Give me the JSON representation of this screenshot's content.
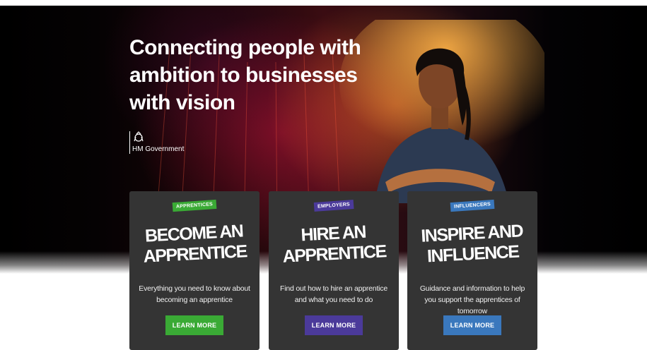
{
  "hero": {
    "title": "Connecting people with ambition to businesses with vision",
    "government_label": "HM Government"
  },
  "cards": [
    {
      "tag": "APPRENTICES",
      "title_line1": "BECOME AN",
      "title_line2": "APPRENTICE",
      "description": "Everything you need to know about becoming an apprentice",
      "button": "LEARN MORE",
      "accent": "#3aaa35"
    },
    {
      "tag": "EMPLOYERS",
      "title_line1": "HIRE AN",
      "title_line2": "APPRENTICE",
      "description": "Find out how to hire an apprentice and what you need to do",
      "button": "LEARN MORE",
      "accent": "#4b3a9a"
    },
    {
      "tag": "INFLUENCERS",
      "title_line1": "INSPIRE AND",
      "title_line2": "INFLUENCE",
      "description": "Guidance and information to help you support the apprentices of tomorrow",
      "button": "LEARN MORE",
      "accent": "#3a78bd"
    }
  ],
  "icons": {
    "crest": "royal-crest-icon"
  },
  "colors": {
    "card_bg": "#343434",
    "hero_bg": "#000000"
  }
}
